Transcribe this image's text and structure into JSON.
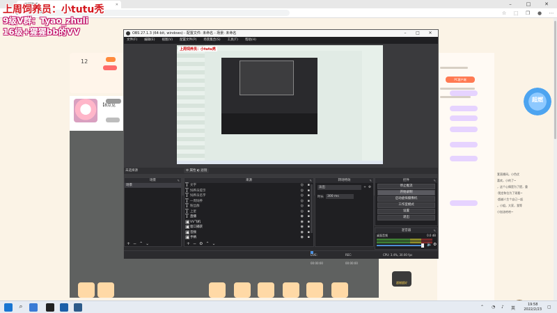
{
  "overlay": {
    "line1": "上周饲养员：小tutu秃",
    "line2": "9级V群：Tyao_zhuli",
    "line3": "16级+猩猩bb的VV"
  },
  "browser": {
    "tab_title": "开播助手",
    "url": "x=2926141"
  },
  "room": {
    "stat_count": "12",
    "pc_client_label": "PC客户端",
    "anchor_name": "【8点见",
    "big_badge": "超燃",
    "right_text": "套直播间。小色优\n喜欢，小的了~\n，这个心情是为了提，重\n·我定和位为了观看~\n·超越人生个自己一起\n。小姐，大家，我等\n小加油哈哈~",
    "tx_badge": "超燃超好"
  },
  "obs": {
    "title": "OBS 27.1.3 (64-bit, windows) - 配置文件: 未命名 - 场景: 未命名",
    "menu": [
      "文件(F)",
      "编辑(E)",
      "视图(V)",
      "配置文件(P)",
      "场景集合(S)",
      "工具(T)",
      "帮助(H)"
    ],
    "preview_overlay_text": "上周饲养员：小tutu秃",
    "scene_bar": {
      "label": "未选择源",
      "props": "属性",
      "filters": "滤镜"
    },
    "docks": {
      "scenes": "场景",
      "sources": "来源",
      "transitions": "转场特效",
      "controls": "控件",
      "mixer": "混音器"
    },
    "scenes": [
      "场景"
    ],
    "sources": [
      {
        "label": "文字",
        "type": "T",
        "visible": false
      },
      {
        "label": "饲养员提示",
        "type": "T",
        "visible": false
      },
      {
        "label": "饲养员名字",
        "type": "T",
        "visible": false
      },
      {
        "label": "一周饲养",
        "type": "T",
        "visible": false
      },
      {
        "label": "粉丝群",
        "type": "T",
        "visible": false
      },
      {
        "label": "上星",
        "type": "T",
        "visible": false
      },
      {
        "label": "直播",
        "type": "T",
        "visible": true
      },
      {
        "label": "VV飞机",
        "type": "I",
        "visible": true
      },
      {
        "label": "窗口捕获",
        "type": "I",
        "visible": true
      },
      {
        "label": "音频",
        "type": "I",
        "visible": true
      },
      {
        "label": "手柄",
        "type": "I",
        "visible": true
      }
    ],
    "transitions": {
      "type": "淡出",
      "duration_label": "时长",
      "duration": "300 ms"
    },
    "controls": [
      "停止推流",
      "开始录制",
      "启动虚拟摄像机",
      "工作室模式",
      "设置",
      "退出"
    ],
    "mixer": {
      "channel": "桌面音频",
      "level": "0.0 dB"
    },
    "status": {
      "live": "LIVE: 00:00:00",
      "rec": "REC: 00:00:00",
      "cpu": "CPU: 3.4%, 30.00 fps"
    }
  },
  "taskbar": {
    "time": "19:58",
    "date": "2022/2/23"
  }
}
